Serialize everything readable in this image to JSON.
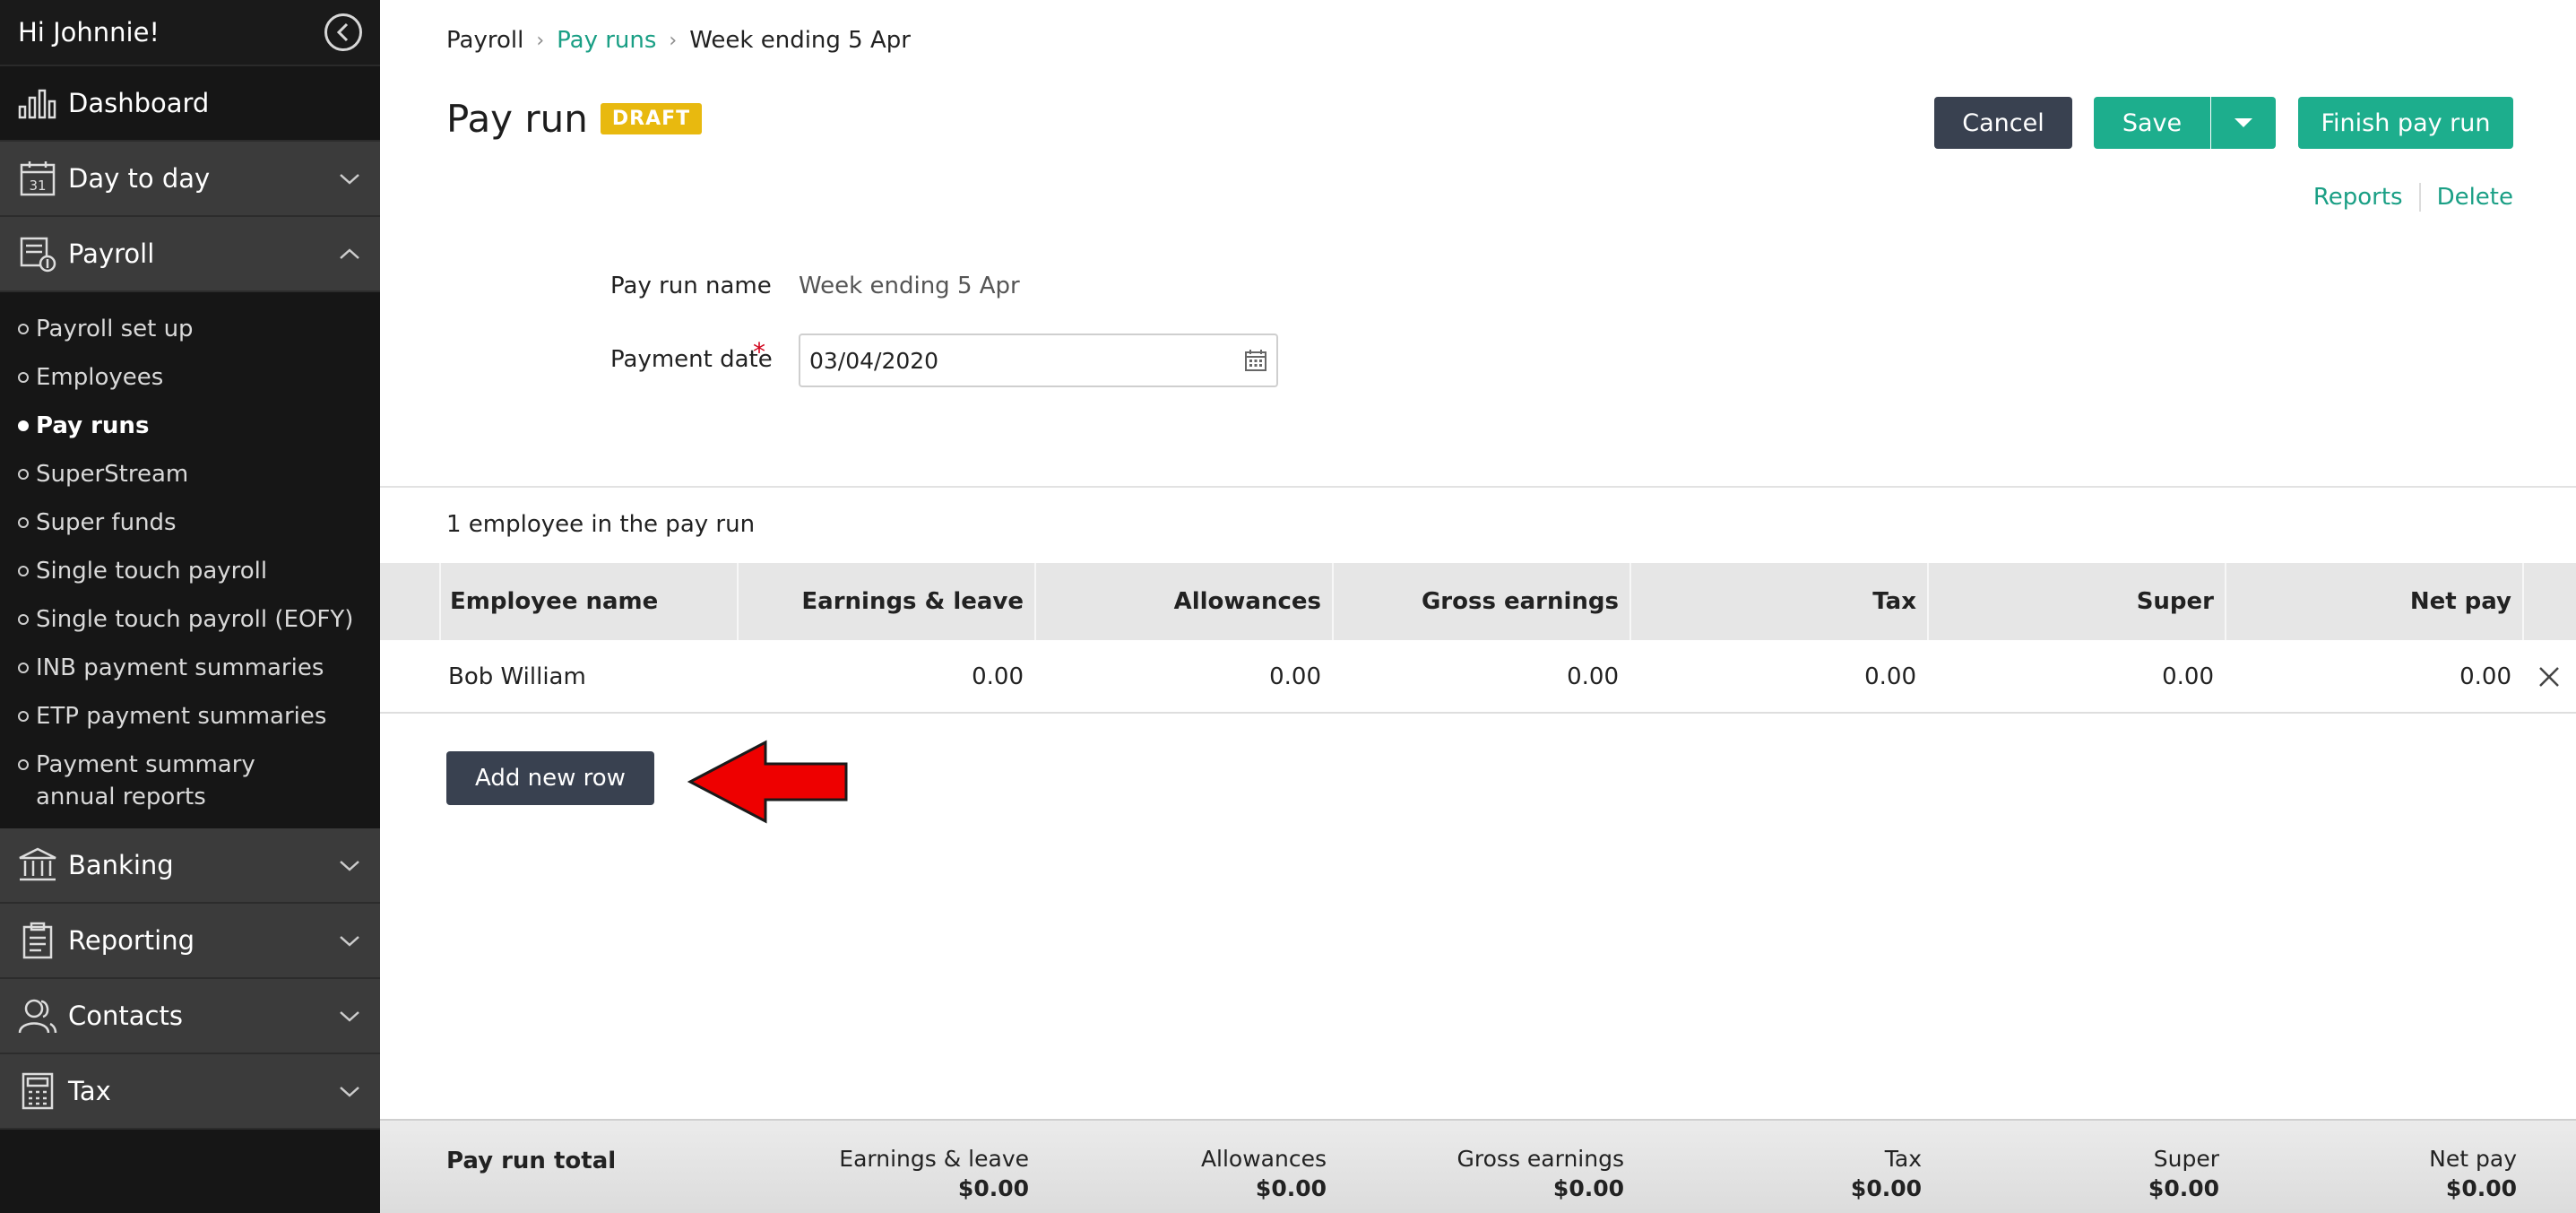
{
  "sidebar": {
    "greeting": "Hi Johnnie!",
    "nav": {
      "dashboard": "Dashboard",
      "day_to_day": "Day to day",
      "payroll": "Payroll",
      "banking": "Banking",
      "reporting": "Reporting",
      "contacts": "Contacts",
      "tax": "Tax"
    },
    "payroll_items": [
      "Payroll set up",
      "Employees",
      "Pay runs",
      "SuperStream",
      "Super funds",
      "Single touch payroll",
      "Single touch payroll (EOFY)",
      "INB payment summaries",
      "ETP payment summaries",
      "Payment summary annual reports"
    ],
    "calendar_day": "31"
  },
  "breadcrumb": [
    "Payroll",
    "Pay runs",
    "Week ending 5 Apr"
  ],
  "page": {
    "title": "Pay run",
    "status_badge": "DRAFT"
  },
  "actions": {
    "cancel": "Cancel",
    "save": "Save",
    "finish": "Finish pay run",
    "reports": "Reports",
    "delete": "Delete"
  },
  "form": {
    "name_label": "Pay run name",
    "name_value": "Week ending 5 Apr",
    "date_label": "Payment date",
    "required_mark": "*",
    "date_value": "03/04/2020"
  },
  "employee_count": "1 employee in the pay run",
  "table": {
    "headers": [
      "Employee name",
      "Earnings & leave",
      "Allowances",
      "Gross earnings",
      "Tax",
      "Super",
      "Net pay"
    ],
    "rows": [
      [
        "Bob William",
        "0.00",
        "0.00",
        "0.00",
        "0.00",
        "0.00",
        "0.00"
      ]
    ]
  },
  "add_row_label": "Add new row",
  "totals": {
    "label": "Pay run total",
    "columns": [
      {
        "name": "Earnings & leave",
        "value": "$0.00"
      },
      {
        "name": "Allowances",
        "value": "$0.00"
      },
      {
        "name": "Gross earnings",
        "value": "$0.00"
      },
      {
        "name": "Tax",
        "value": "$0.00"
      },
      {
        "name": "Super",
        "value": "$0.00"
      },
      {
        "name": "Net pay",
        "value": "$0.00"
      }
    ]
  },
  "colors": {
    "accent": "#1dae8d",
    "dark_button": "#394150",
    "badge": "#e8b90f",
    "arrow": "#ee0000"
  }
}
